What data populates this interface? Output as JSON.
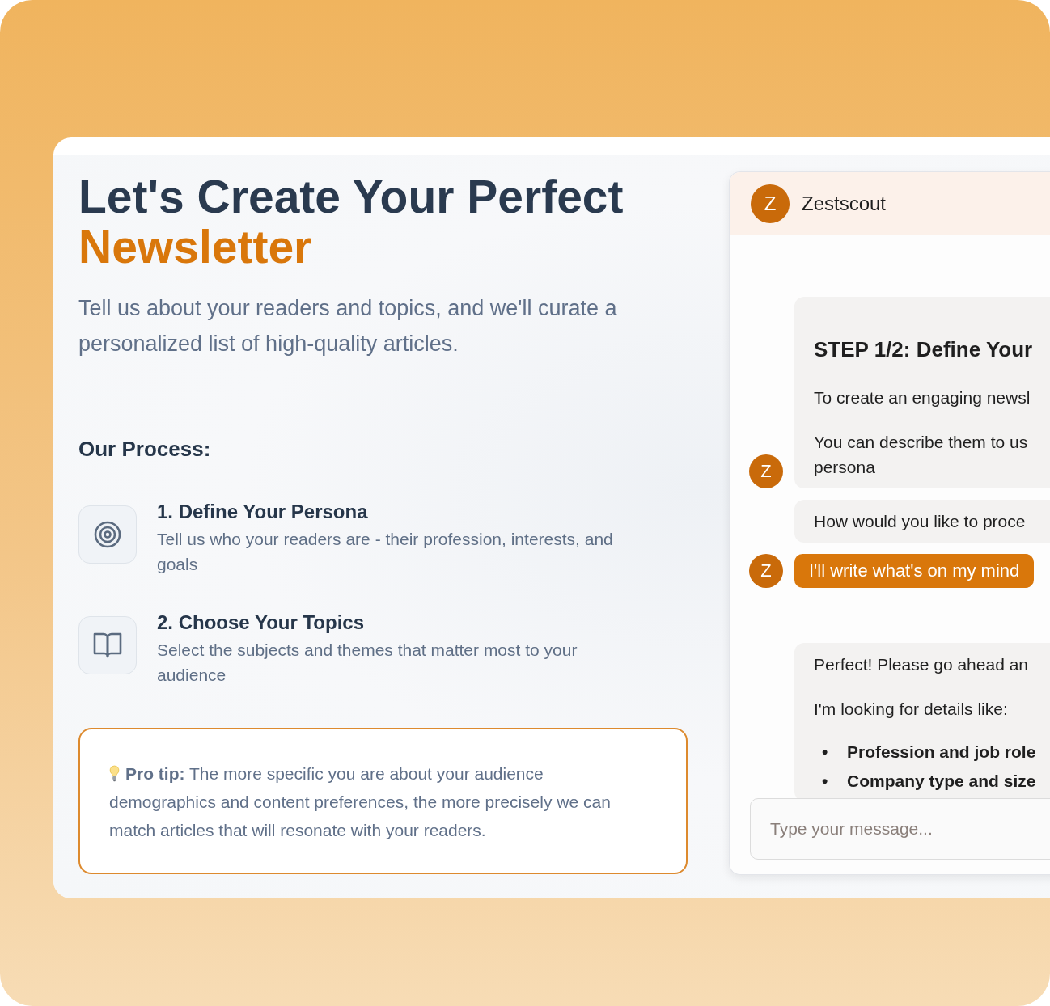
{
  "hero": {
    "title": "Let's Create Your Perfect",
    "title_highlight": "Newsletter",
    "subtitle": "Tell us about your readers and topics, and we'll curate a personalized list of high-quality articles."
  },
  "process": {
    "heading": "Our Process:",
    "steps": [
      {
        "kind": "target",
        "title": "1. Define Your Persona",
        "description": "Tell us who your readers are - their profession, interests, and goals"
      },
      {
        "kind": "book",
        "title": "2. Choose Your Topics",
        "description": "Select the subjects and themes that matter most to your audience"
      }
    ]
  },
  "tip": {
    "text": "**Pro tip:** The more specific you are about your audience demographics and content preferences, the more precisely we can match articles that will resonate with your readers."
  },
  "chat": {
    "avatar": "Z",
    "bot_name": "Zestscout",
    "messages": [
      {
        "kind": "bot",
        "avatar": "Z",
        "title": "STEP 1/2: Define Your",
        "paragraphs": [
          "To create an engaging newsl",
          "You can describe them to us\npersona"
        ]
      },
      {
        "kind": "bot",
        "paragraphs": [
          "How would you like to proce"
        ]
      },
      {
        "kind": "option",
        "avatar": "Z",
        "text": "I'll write what's on my mind"
      },
      {
        "kind": "bot",
        "paragraphs": [
          "Perfect! Please go ahead an",
          "I'm looking for details like:"
        ],
        "bullet_marker": "•",
        "bullets": [
          "Profession and job role",
          "Company type and size"
        ]
      }
    ],
    "input": {
      "placeholder": "Type your message..."
    }
  }
}
